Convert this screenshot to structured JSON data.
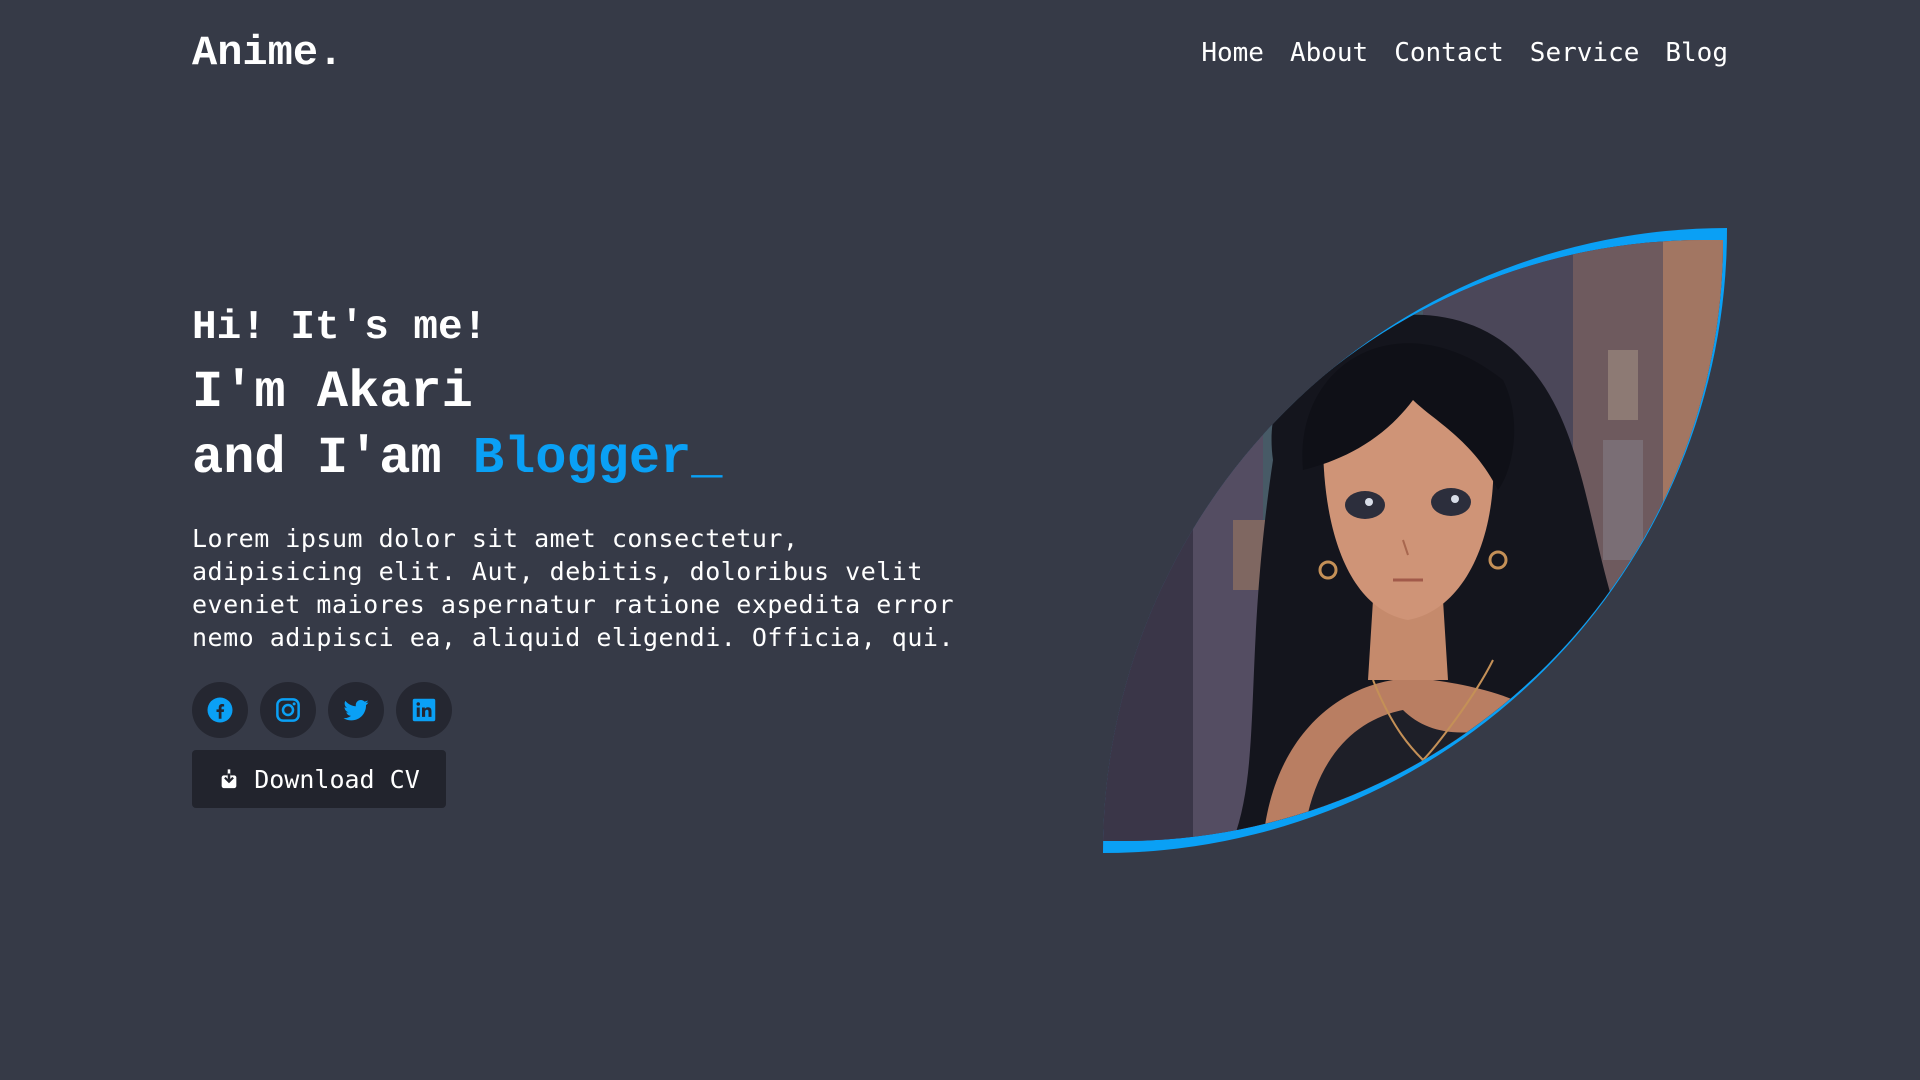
{
  "brand": {
    "logo": "Anime."
  },
  "nav": {
    "items": [
      {
        "label": "Home"
      },
      {
        "label": "About"
      },
      {
        "label": "Contact"
      },
      {
        "label": "Service"
      },
      {
        "label": "Blog"
      }
    ]
  },
  "hero": {
    "greeting": "Hi! It's me!",
    "name": "I'm Akari",
    "role_prefix": "and I'am ",
    "role_accent": "Blogger_",
    "description": "Lorem ipsum dolor sit amet consectetur, adipisicing elit. Aut, debitis, doloribus velit eveniet maiores aspernatur ratione expedita error nemo adipisci ea, aliquid eligendi. Officia, qui.",
    "cv_button_label": "Download CV",
    "image_alt": "Anime portrait of Akari"
  },
  "socials": [
    {
      "icon": "facebook-icon"
    },
    {
      "icon": "instagram-icon"
    },
    {
      "icon": "twitter-icon"
    },
    {
      "icon": "linkedin-icon"
    }
  ],
  "colors": {
    "background": "#363a47",
    "accent": "#0aa0f5",
    "dark": "#252731",
    "text": "#ffffff"
  }
}
